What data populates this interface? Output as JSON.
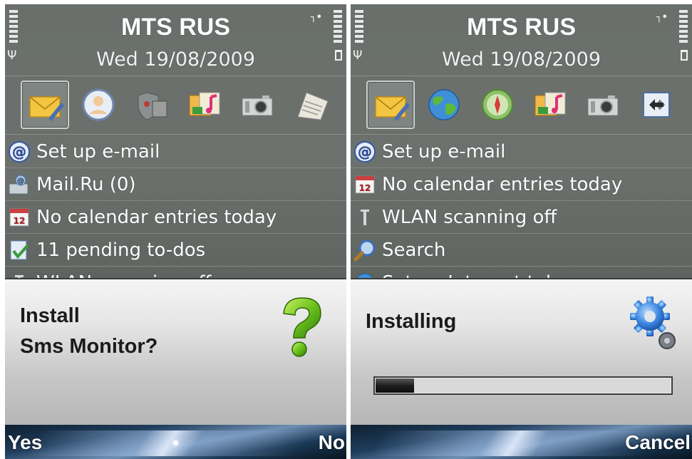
{
  "left": {
    "operator": "MTS RUS",
    "date": "Wed 19/08/2009",
    "shortcuts": [
      "envelope-icon",
      "contacts-icon",
      "shield-icon",
      "gallery-icon",
      "camera-icon",
      "notes-icon"
    ],
    "list": [
      {
        "icon": "at-icon",
        "label": "Set up e-mail"
      },
      {
        "icon": "mail-user-icon",
        "label": "Mail.Ru (0)"
      },
      {
        "icon": "calendar-icon",
        "label": "No calendar entries today"
      },
      {
        "icon": "todo-icon",
        "label": "11 pending to-dos"
      },
      {
        "icon": "wlan-icon",
        "label": "WLAN scanning off"
      }
    ],
    "dialog": {
      "line1": "Install",
      "line2": "Sms Monitor?",
      "icon": "question-icon"
    },
    "softkeys": {
      "left": "Yes",
      "right": "No"
    }
  },
  "right": {
    "operator": "MTS RUS",
    "date": "Wed 19/08/2009",
    "shortcuts": [
      "envelope-icon",
      "globe-icon",
      "compass-icon",
      "gallery-icon",
      "camera-icon",
      "sync-icon"
    ],
    "list": [
      {
        "icon": "at-icon",
        "label": "Set up e-mail"
      },
      {
        "icon": "calendar-icon",
        "label": "No calendar entries today"
      },
      {
        "icon": "wlan-icon",
        "label": "WLAN scanning off"
      },
      {
        "icon": "search-icon",
        "label": "Search"
      },
      {
        "icon": "globe-icon",
        "label": "Set up Internet tel..."
      }
    ],
    "dialog": {
      "title": "Installing",
      "icon": "gear-icon",
      "progress": 0.13
    },
    "softkeys": {
      "right": "Cancel"
    }
  },
  "colors": {
    "dialog_text": "#1b1b1b",
    "screen_bg": "#6a6f6b",
    "softkey_bar": "#1f3d5c"
  }
}
